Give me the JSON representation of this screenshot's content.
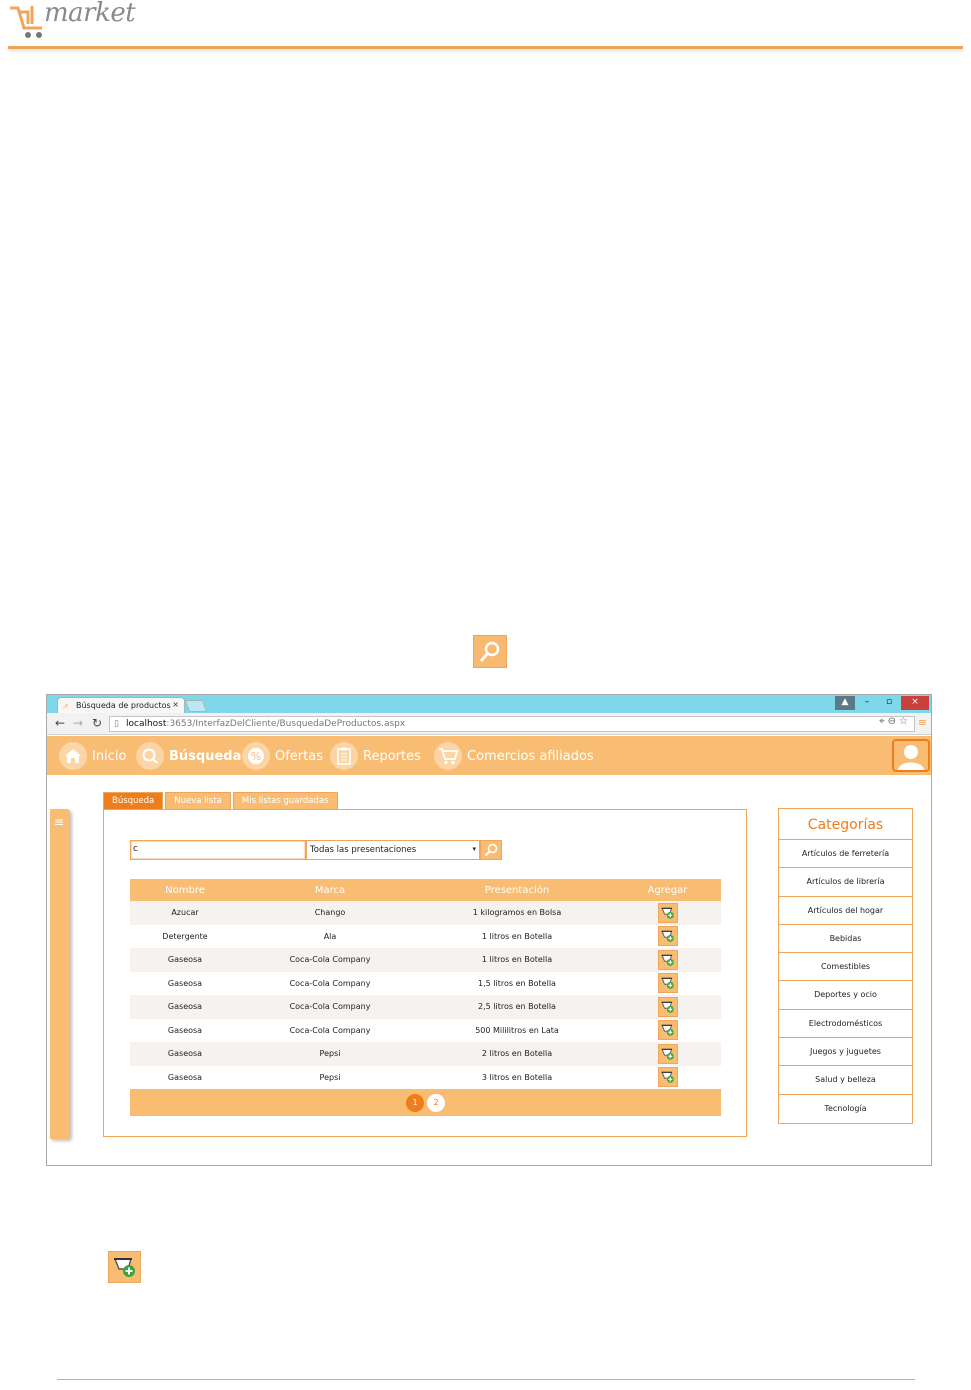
{
  "brand": {
    "logo_text": "market",
    "accent": "#f8bd72",
    "accent_dark": "#ee7d1c"
  },
  "browser": {
    "tab_title": "Búsqueda de productos",
    "tab_close": "×",
    "url_host": "localhost",
    "url_path": ":3653/InterfazDelCliente/BusquedaDeProductos.aspx",
    "window_buttons": {
      "minimize": "–",
      "restore": "▫",
      "close": "×"
    }
  },
  "nav": {
    "items": [
      {
        "label": "Inicio",
        "icon": "home-icon"
      },
      {
        "label": "Búsqueda",
        "icon": "search-icon"
      },
      {
        "label": "Ofertas",
        "icon": "percent-icon"
      },
      {
        "label": "Reportes",
        "icon": "clipboard-icon"
      },
      {
        "label": "Comercios afiliados",
        "icon": "cart-icon"
      }
    ],
    "active": "Búsqueda"
  },
  "tabs": [
    "Búsqueda",
    "Nueva lista",
    "Mis listas guardadas"
  ],
  "search": {
    "input_value": "c",
    "select_value": "Todas las presentaciones",
    "select_caret": "▾"
  },
  "grid": {
    "headers": [
      "Nombre",
      "Marca",
      "Presentación",
      "Agregar"
    ],
    "rows": [
      [
        "Azucar",
        "Chango",
        "1 kilogramos en Bolsa"
      ],
      [
        "Detergente",
        "Ala",
        "1 litros en Botella"
      ],
      [
        "Gaseosa",
        "Coca-Cola Company",
        "1 litros en Botella"
      ],
      [
        "Gaseosa",
        "Coca-Cola Company",
        "1,5 litros en Botella"
      ],
      [
        "Gaseosa",
        "Coca-Cola Company",
        "2,5 litros en Botella"
      ],
      [
        "Gaseosa",
        "Coca-Cola Company",
        "500 Mililitros en Lata"
      ],
      [
        "Gaseosa",
        "Pepsi",
        "2 litros en Botella"
      ],
      [
        "Gaseosa",
        "Pepsi",
        "3 litros en Botella"
      ]
    ],
    "pages": [
      "1",
      "2"
    ],
    "current_page": "1"
  },
  "categories": {
    "title": "Categorías",
    "items": [
      "Artículos de ferretería",
      "Artículos de librería",
      "Artículos del hogar",
      "Bebidas",
      "Comestibles",
      "Deportes y ocio",
      "Electrodomésticos",
      "Juegos y juguetes",
      "Salud y belleza",
      "Tecnología"
    ]
  }
}
